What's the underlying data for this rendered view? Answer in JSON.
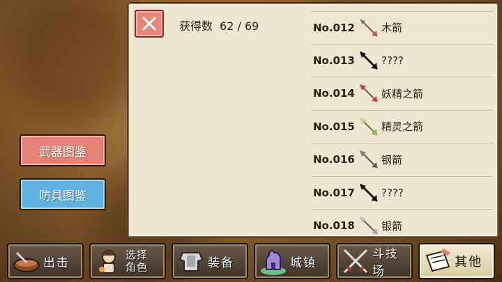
{
  "collection": {
    "count_label": "获得数",
    "count_value": "62 / 69",
    "close_icon": "close-icon",
    "items": [
      {
        "num": "No.012",
        "name": "木箭",
        "icon": "arrow-icon",
        "color": "#c0504a"
      },
      {
        "num": "No.013",
        "name": "????",
        "icon": "arrow-silhouette-icon",
        "color": "#111111"
      },
      {
        "num": "No.014",
        "name": "妖精之箭",
        "icon": "arrow-icon",
        "color": "#c8344f"
      },
      {
        "num": "No.015",
        "name": "精灵之箭",
        "icon": "arrow-icon",
        "color": "#8bbf5a"
      },
      {
        "num": "No.016",
        "name": "钢箭",
        "icon": "arrow-icon",
        "color": "#7d7d7d"
      },
      {
        "num": "No.017",
        "name": "????",
        "icon": "arrow-silhouette-icon",
        "color": "#111111"
      },
      {
        "num": "No.018",
        "name": "银箭",
        "icon": "arrow-icon",
        "color": "#9aa3a8"
      }
    ]
  },
  "side_menu": {
    "weapon_label": "武器图鉴",
    "armor_label": "防具图鉴",
    "weapon_color": "#e58074",
    "armor_color": "#5fb1df"
  },
  "nav": [
    {
      "label": "出击",
      "icon": "wok-icon"
    },
    {
      "label_line1": "选择",
      "label_line2": "角色",
      "icon": "character-icon"
    },
    {
      "label": "装备",
      "icon": "armor-icon"
    },
    {
      "label": "城镇",
      "icon": "castle-icon"
    },
    {
      "label": "斗技场",
      "icon": "crossed-swords-icon"
    },
    {
      "label": "其他",
      "icon": "scroll-icon",
      "active": true
    }
  ]
}
